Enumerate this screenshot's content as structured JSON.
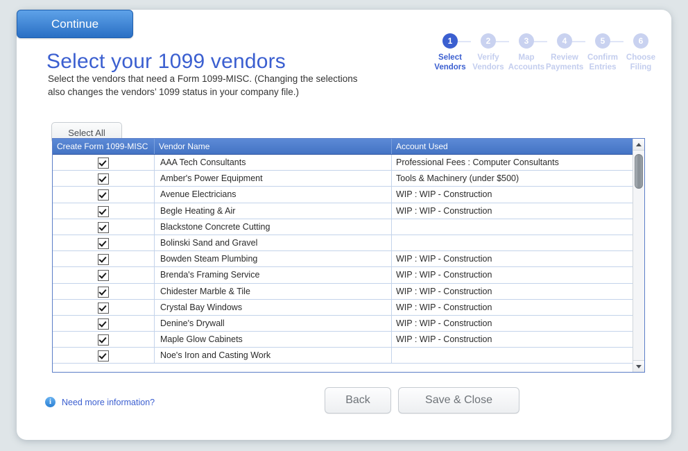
{
  "page": {
    "title": "Select your 1099 vendors",
    "subtitle": "Select the vendors that need a Form 1099-MISC. (Changing the selections also changes the vendors’ 1099 status in your company file.)"
  },
  "stepper": {
    "steps": [
      {
        "number": "1",
        "line1": "Select",
        "line2": "Vendors",
        "active": true
      },
      {
        "number": "2",
        "line1": "Verify",
        "line2": "Vendors",
        "active": false
      },
      {
        "number": "3",
        "line1": "Map",
        "line2": "Accounts",
        "active": false
      },
      {
        "number": "4",
        "line1": "Review",
        "line2": "Payments",
        "active": false
      },
      {
        "number": "5",
        "line1": "Confirm",
        "line2": "Entries",
        "active": false
      },
      {
        "number": "6",
        "line1": "Choose",
        "line2": "Filing",
        "active": false
      }
    ],
    "active_color": "#3b5fd0",
    "inactive_color": "#c3cdee"
  },
  "toolbar": {
    "select_all_label": "Select All"
  },
  "table": {
    "columns": [
      "Create Form 1099-MISC",
      "Vendor Name",
      "Account Used"
    ],
    "rows": [
      {
        "checked": true,
        "vendor": "AAA Tech Consultants",
        "account": "Professional Fees : Computer Consultants"
      },
      {
        "checked": true,
        "vendor": "Amber's Power Equipment",
        "account": "Tools & Machinery (under $500)"
      },
      {
        "checked": true,
        "vendor": "Avenue Electricians",
        "account": "WIP : WIP - Construction"
      },
      {
        "checked": true,
        "vendor": "Begle Heating & Air",
        "account": "WIP : WIP - Construction"
      },
      {
        "checked": true,
        "vendor": "Blackstone Concrete Cutting",
        "account": ""
      },
      {
        "checked": true,
        "vendor": "Bolinski Sand and Gravel",
        "account": ""
      },
      {
        "checked": true,
        "vendor": "Bowden Steam Plumbing",
        "account": "WIP : WIP - Construction"
      },
      {
        "checked": true,
        "vendor": "Brenda's Framing Service",
        "account": "WIP : WIP - Construction"
      },
      {
        "checked": true,
        "vendor": "Chidester Marble & Tile",
        "account": "WIP : WIP - Construction"
      },
      {
        "checked": true,
        "vendor": "Crystal Bay Windows",
        "account": "WIP : WIP - Construction"
      },
      {
        "checked": true,
        "vendor": "Denine's Drywall",
        "account": "WIP : WIP - Construction"
      },
      {
        "checked": true,
        "vendor": "Maple Glow Cabinets",
        "account": "WIP : WIP - Construction"
      },
      {
        "checked": true,
        "vendor": "Noe's Iron and Casting Work",
        "account": ""
      }
    ],
    "header_color": "#4474c4"
  },
  "footer": {
    "info_icon": "info-icon",
    "need_info_label": "Need more information?",
    "back_label": "Back",
    "save_close_label": "Save & Close",
    "continue_label": "Continue",
    "continue_color": "#2a6fc4"
  }
}
